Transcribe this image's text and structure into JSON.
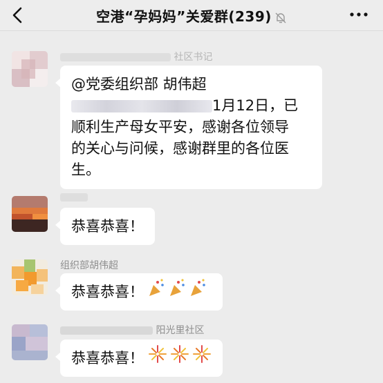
{
  "header": {
    "title": "空港“孕妈妈”关爱群(239)",
    "back_icon": "chevron-left-icon",
    "mute_icon": "bell-off-icon",
    "more_icon": "more-dots-icon"
  },
  "messages": [
    {
      "sender": "社区书记",
      "lines": [
        "@党委组织部 胡伟超",
        "1月12日，已",
        "顺利生产母女平安，感谢各位领导",
        "的关心与问候，感谢群里的各位医",
        "生。"
      ]
    },
    {
      "sender": "",
      "text": "恭喜恭喜！"
    },
    {
      "sender": "组织部胡伟超",
      "text": "恭喜恭喜！",
      "emoji_icon": "party-popper-icon"
    },
    {
      "sender": "阳光里社区",
      "text": "恭喜恭喜！",
      "emoji_icon": "fireworks-icon"
    }
  ],
  "colors": {
    "background": "#ececec",
    "bubble": "#ffffff",
    "sender_text": "#8e8e8e"
  }
}
